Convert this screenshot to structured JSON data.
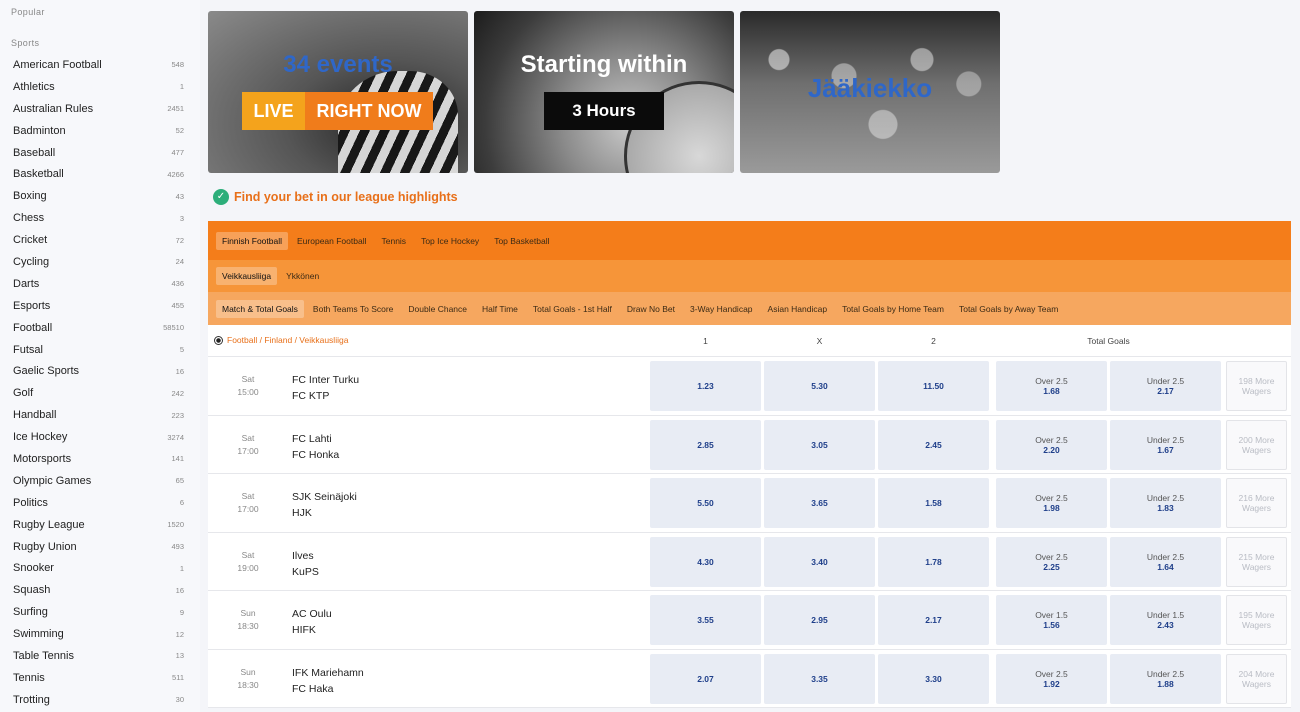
{
  "sidebar": {
    "popular_heading": "Popular",
    "sports_heading": "Sports",
    "sports": [
      {
        "name": "American Football",
        "count": "548"
      },
      {
        "name": "Athletics",
        "count": "1"
      },
      {
        "name": "Australian Rules",
        "count": "2451"
      },
      {
        "name": "Badminton",
        "count": "52"
      },
      {
        "name": "Baseball",
        "count": "477"
      },
      {
        "name": "Basketball",
        "count": "4266"
      },
      {
        "name": "Boxing",
        "count": "43"
      },
      {
        "name": "Chess",
        "count": "3"
      },
      {
        "name": "Cricket",
        "count": "72"
      },
      {
        "name": "Cycling",
        "count": "24"
      },
      {
        "name": "Darts",
        "count": "436"
      },
      {
        "name": "Esports",
        "count": "455"
      },
      {
        "name": "Football",
        "count": "58510"
      },
      {
        "name": "Futsal",
        "count": "5"
      },
      {
        "name": "Gaelic Sports",
        "count": "16"
      },
      {
        "name": "Golf",
        "count": "242"
      },
      {
        "name": "Handball",
        "count": "223"
      },
      {
        "name": "Ice Hockey",
        "count": "3274"
      },
      {
        "name": "Motorsports",
        "count": "141"
      },
      {
        "name": "Olympic Games",
        "count": "65"
      },
      {
        "name": "Politics",
        "count": "6"
      },
      {
        "name": "Rugby League",
        "count": "1520"
      },
      {
        "name": "Rugby Union",
        "count": "493"
      },
      {
        "name": "Snooker",
        "count": "1"
      },
      {
        "name": "Squash",
        "count": "16"
      },
      {
        "name": "Surfing",
        "count": "9"
      },
      {
        "name": "Swimming",
        "count": "12"
      },
      {
        "name": "Table Tennis",
        "count": "13"
      },
      {
        "name": "Tennis",
        "count": "511"
      },
      {
        "name": "Trotting",
        "count": "30"
      }
    ]
  },
  "banners": {
    "live": {
      "events": "34 events",
      "live_label": "LIVE",
      "now_label": "RIGHT NOW"
    },
    "starting": {
      "title": "Starting within",
      "cta": "3 Hours"
    },
    "sport": {
      "title": "Jääkiekko"
    }
  },
  "highlights": {
    "text": "Find your bet in our league highlights"
  },
  "tabs_sport": [
    {
      "label": "Finnish Football",
      "active": true
    },
    {
      "label": "European Football",
      "active": false
    },
    {
      "label": "Tennis",
      "active": false
    },
    {
      "label": "Top Ice Hockey",
      "active": false
    },
    {
      "label": "Top Basketball",
      "active": false
    }
  ],
  "tabs_league": [
    {
      "label": "Veikkausliiga",
      "active": true
    },
    {
      "label": "Ykkönen",
      "active": false
    }
  ],
  "tabs_market": [
    {
      "label": "Match & Total Goals",
      "active": true
    },
    {
      "label": "Both Teams To Score",
      "active": false
    },
    {
      "label": "Double Chance",
      "active": false
    },
    {
      "label": "Half Time",
      "active": false
    },
    {
      "label": "Total Goals - 1st Half",
      "active": false
    },
    {
      "label": "Draw No Bet",
      "active": false
    },
    {
      "label": "3-Way Handicap",
      "active": false
    },
    {
      "label": "Asian Handicap",
      "active": false
    },
    {
      "label": "Total Goals by Home Team",
      "active": false
    },
    {
      "label": "Total Goals by Away Team",
      "active": false
    }
  ],
  "table": {
    "league_path": "Football / Finland / Veikkausliiga",
    "headers": {
      "home": "1",
      "draw": "X",
      "away": "2",
      "total": "Total Goals"
    },
    "matches": [
      {
        "day": "Sat",
        "time": "15:00",
        "home": "FC Inter Turku",
        "away": "FC KTP",
        "o1": "1.23",
        "ox": "5.30",
        "o2": "11.50",
        "over_label": "Over 2.5",
        "over_odd": "1.68",
        "under_label": "Under 2.5",
        "under_odd": "2.17",
        "more": "198 More Wagers"
      },
      {
        "day": "Sat",
        "time": "17:00",
        "home": "FC Lahti",
        "away": "FC Honka",
        "o1": "2.85",
        "ox": "3.05",
        "o2": "2.45",
        "over_label": "Over 2.5",
        "over_odd": "2.20",
        "under_label": "Under 2.5",
        "under_odd": "1.67",
        "more": "200 More Wagers"
      },
      {
        "day": "Sat",
        "time": "17:00",
        "home": "SJK Seinäjoki",
        "away": "HJK",
        "o1": "5.50",
        "ox": "3.65",
        "o2": "1.58",
        "over_label": "Over 2.5",
        "over_odd": "1.98",
        "under_label": "Under 2.5",
        "under_odd": "1.83",
        "more": "216 More Wagers"
      },
      {
        "day": "Sat",
        "time": "19:00",
        "home": "Ilves",
        "away": "KuPS",
        "o1": "4.30",
        "ox": "3.40",
        "o2": "1.78",
        "over_label": "Over 2.5",
        "over_odd": "2.25",
        "under_label": "Under 2.5",
        "under_odd": "1.64",
        "more": "215 More Wagers"
      },
      {
        "day": "Sun",
        "time": "18:30",
        "home": "AC Oulu",
        "away": "HIFK",
        "o1": "3.55",
        "ox": "2.95",
        "o2": "2.17",
        "over_label": "Over 1.5",
        "over_odd": "1.56",
        "under_label": "Under 1.5",
        "under_odd": "2.43",
        "more": "195 More Wagers"
      },
      {
        "day": "Sun",
        "time": "18:30",
        "home": "IFK Mariehamn",
        "away": "FC Haka",
        "o1": "2.07",
        "ox": "3.35",
        "o2": "3.30",
        "over_label": "Over 2.5",
        "over_odd": "1.92",
        "under_label": "Under 2.5",
        "under_odd": "1.88",
        "more": "204 More Wagers"
      }
    ]
  }
}
